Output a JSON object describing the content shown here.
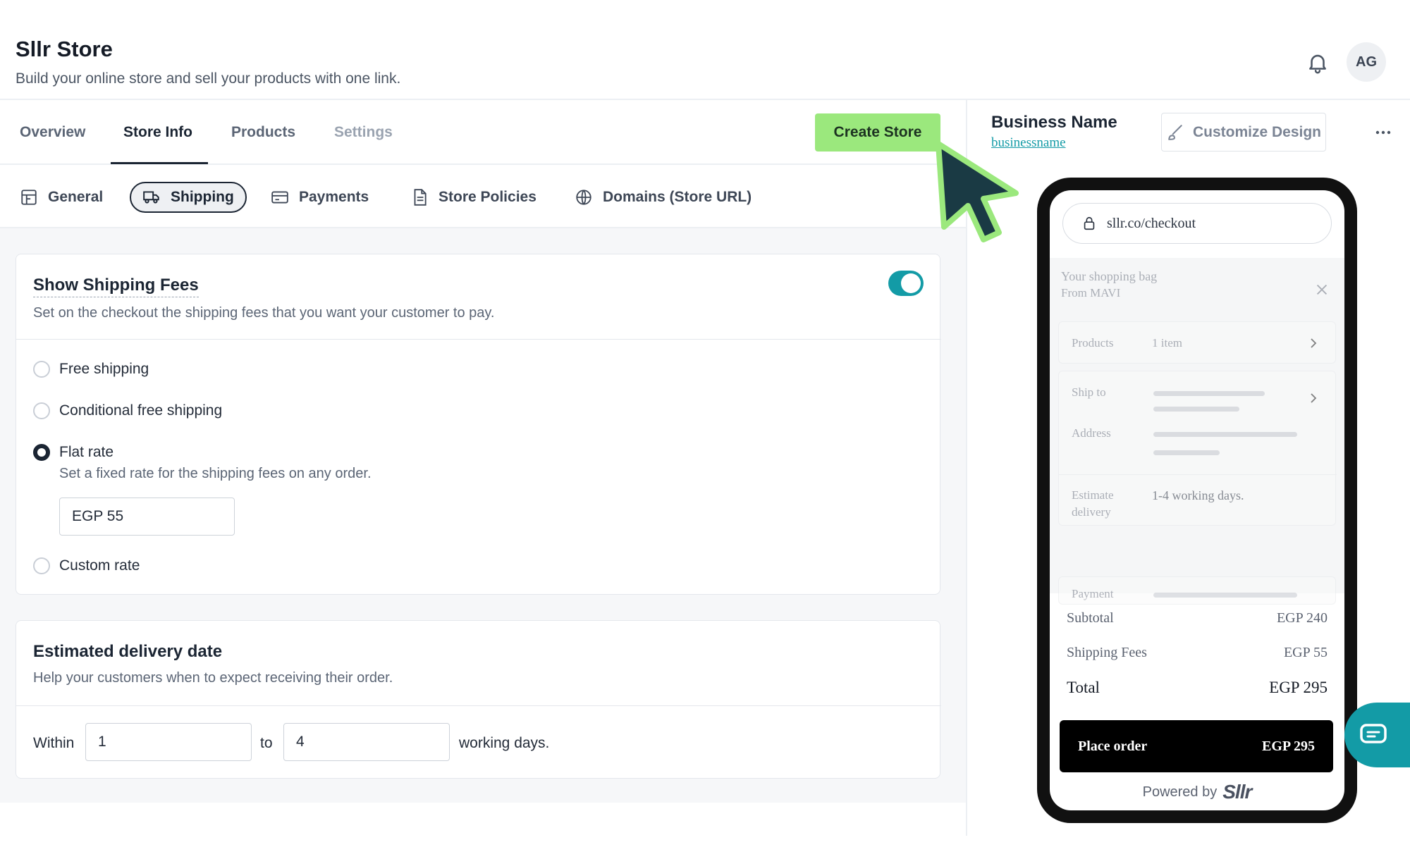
{
  "header": {
    "title": "Sllr Store",
    "subtitle": "Build your online store and sell your products with one link.",
    "avatar_initials": "AG",
    "notification_icon": "bell-icon"
  },
  "tabs": [
    {
      "label": "Overview"
    },
    {
      "label": "Store Info"
    },
    {
      "label": "Products"
    },
    {
      "label": "Settings"
    }
  ],
  "active_tab": "Store Info",
  "create_store_label": "Create Store",
  "subtabs": [
    {
      "label": "General",
      "icon": "store-icon"
    },
    {
      "label": "Shipping",
      "icon": "truck-icon"
    },
    {
      "label": "Payments",
      "icon": "credit-card-icon"
    },
    {
      "label": "Store Policies",
      "icon": "document-icon"
    },
    {
      "label": "Domains (Store URL)",
      "icon": "globe-icon"
    }
  ],
  "active_subtab": "Shipping",
  "shipping_fees": {
    "title": "Show Shipping Fees",
    "description": "Set on the checkout the shipping fees that you want your customer to pay.",
    "enabled": true,
    "options": [
      {
        "label": "Free shipping",
        "selected": false
      },
      {
        "label": "Conditional free shipping",
        "selected": false
      },
      {
        "label": "Flat rate",
        "selected": true,
        "description": "Set a fixed rate for the shipping fees on any order.",
        "value": "EGP 55"
      },
      {
        "label": "Custom rate",
        "selected": false
      }
    ]
  },
  "delivery": {
    "title": "Estimated delivery date",
    "description": "Help your customers when to expect receiving their order.",
    "within_label": "Within",
    "from_value": "1",
    "to_label": "to",
    "to_value": "4",
    "suffix": "working days."
  },
  "preview": {
    "business_name": "Business Name",
    "business_link": "businessname",
    "customize_label": "Customize Design",
    "url": "sllr.co/checkout",
    "bag_title": "Your shopping bag",
    "bag_from": "From MAVI",
    "products_label": "Products",
    "products_value": "1 item",
    "ship_to_label": "Ship to",
    "address_label": "Address",
    "estimate_label_1": "Estimate",
    "estimate_label_2": "delivery",
    "estimate_value": "1-4 working days.",
    "payment_label": "Payment",
    "subtotal_label": "Subtotal",
    "subtotal_value": "EGP 240",
    "shipping_label": "Shipping Fees",
    "shipping_value": "EGP 55",
    "total_label": "Total",
    "total_value": "EGP 295",
    "place_order_label": "Place order",
    "place_order_value": "EGP 295",
    "powered_by": "Powered by",
    "logo_text": "Sllr"
  },
  "colors": {
    "accent_teal": "#139ba6",
    "create_green": "#9be87d",
    "cursor_fill": "#1a3a44",
    "cursor_outline": "#9be87d"
  }
}
